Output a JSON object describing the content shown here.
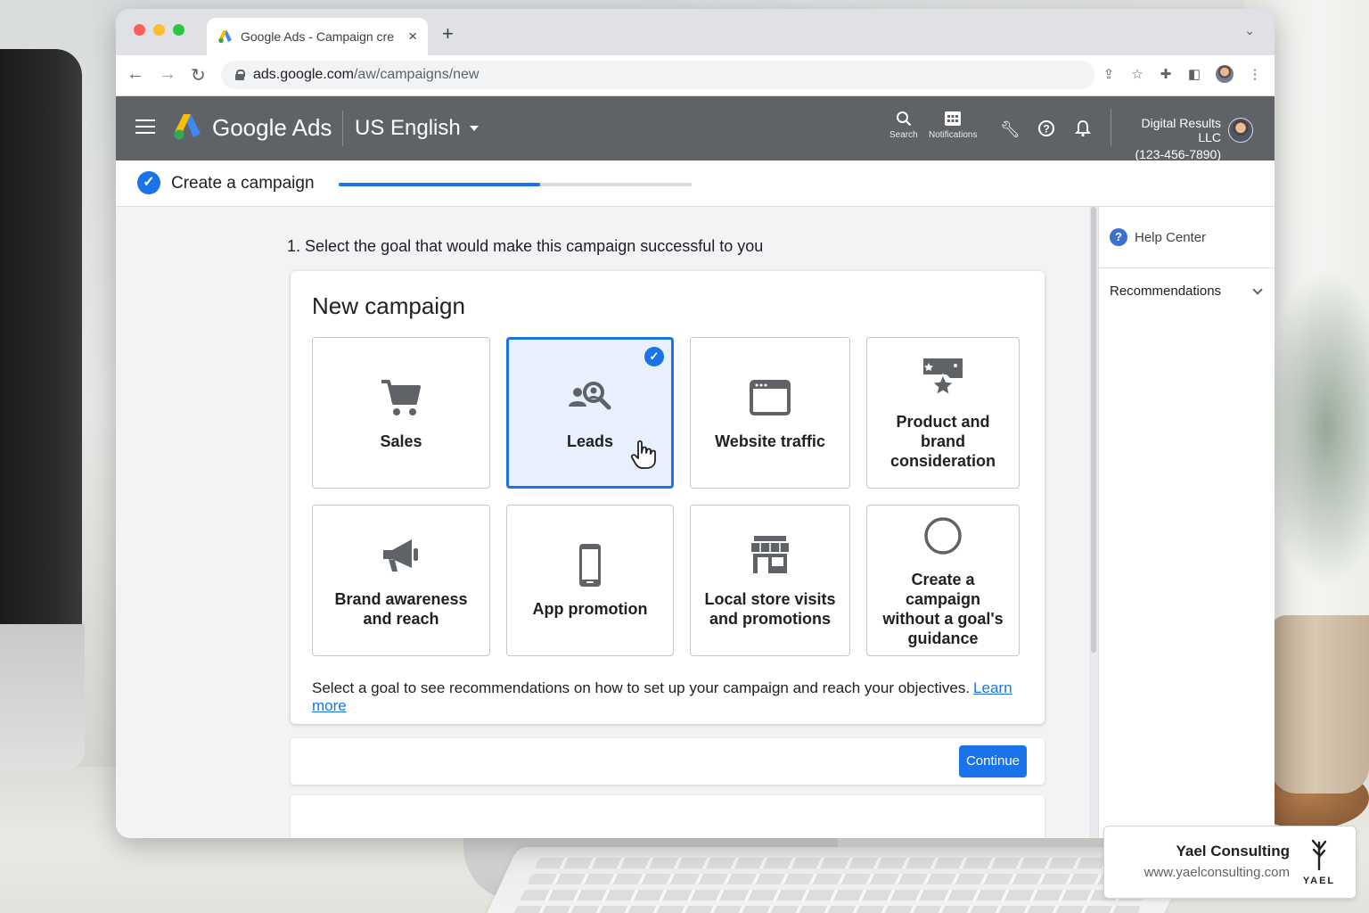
{
  "browser": {
    "tab_title": "Google Ads - Campaign cre",
    "url_host": "ads.google.com",
    "url_path": "/aw/campaigns/new",
    "new_tab_label": "+",
    "tab_close_label": "×"
  },
  "header": {
    "brand": "Google Ads",
    "language": "US English",
    "tools": [
      {
        "icon": "search-icon",
        "label": "Search"
      },
      {
        "icon": "notifications-grid-icon",
        "label": "Notifications"
      }
    ],
    "account": {
      "name": "Digital Results LLC",
      "phone": "(123-456-7890)"
    }
  },
  "progress": {
    "title": "Create a campaign",
    "fraction": 0.57
  },
  "main": {
    "question": "1. Select the goal that would make this campaign successful to you",
    "card_title": "New campaign",
    "goals": [
      {
        "label": "Sales",
        "icon": "cart-icon",
        "selected": false
      },
      {
        "label": "Leads",
        "icon": "people-search-icon",
        "selected": true
      },
      {
        "label": "Website traffic",
        "icon": "browser-window-icon",
        "selected": false
      },
      {
        "label": "Product and brand consideration",
        "icon": "star-sparkle-icon",
        "selected": false
      },
      {
        "label": "Brand awareness and reach",
        "icon": "megaphone-icon",
        "selected": false
      },
      {
        "label": "App promotion",
        "icon": "phone-icon",
        "selected": false
      },
      {
        "label": "Local store visits and promotions",
        "icon": "storefront-icon",
        "selected": false
      },
      {
        "label": "Create a campaign without a goal's guidance",
        "icon": "empty-circle-icon",
        "selected": false
      }
    ],
    "hint": "Select a goal to see recommendations on how to set up your campaign and reach your objectives.",
    "learn_more": "Learn more",
    "continue_label": "Continue"
  },
  "side_panel": {
    "help_label": "Help Center",
    "recommendations_label": "Recommendations"
  },
  "watermark": {
    "name": "Yael Consulting",
    "url": "www.yaelconsulting.com",
    "logo_text": "YAEL"
  },
  "colors": {
    "accent": "#1a73e8",
    "header_bg": "#5f6368",
    "selected_bg": "#e8f0fe"
  }
}
